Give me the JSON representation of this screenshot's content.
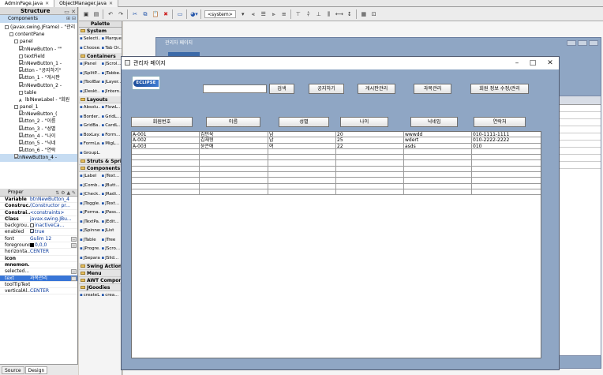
{
  "editor_tabs": [
    {
      "label": "AdminPage.java",
      "active": true
    },
    {
      "label": "ObjectManager.java",
      "active": false
    }
  ],
  "structure": {
    "title": "Structure",
    "components_label": "Components",
    "tree": [
      {
        "label": "(javax.swing.JFrame) - \"관리",
        "indent": 1,
        "icon": "frame"
      },
      {
        "label": "contentPane",
        "indent": 2,
        "icon": "panel"
      },
      {
        "label": "panel",
        "indent": 3,
        "icon": "panel"
      },
      {
        "label": "btnNewButton - \"\"",
        "indent": 4,
        "icon": "btn"
      },
      {
        "label": "textField",
        "indent": 4,
        "icon": "panel"
      },
      {
        "label": "btnNewButton_1 -",
        "indent": 4,
        "icon": "btn"
      },
      {
        "label": "button - \"공지하기\"",
        "indent": 4,
        "icon": "btn"
      },
      {
        "label": "button_1 - \"게시판",
        "indent": 4,
        "icon": "btn"
      },
      {
        "label": "btnNewButton_2 -",
        "indent": 4,
        "icon": "btn"
      },
      {
        "label": "table",
        "indent": 4,
        "icon": "panel"
      },
      {
        "label": "lblNewLabel - \"회원",
        "indent": 4,
        "icon": "lbl"
      },
      {
        "label": "panel_1",
        "indent": 3,
        "icon": "panel"
      },
      {
        "label": "btnNewButton_(",
        "indent": 4,
        "icon": "btn"
      },
      {
        "label": "button_2 - \"이름",
        "indent": 4,
        "icon": "btn"
      },
      {
        "label": "button_3 - \"성별",
        "indent": 4,
        "icon": "btn"
      },
      {
        "label": "button_4 - \"나이",
        "indent": 4,
        "icon": "btn"
      },
      {
        "label": "button_5 - \"닉네",
        "indent": 4,
        "icon": "btn"
      },
      {
        "label": "button_6 - \"연락",
        "indent": 4,
        "icon": "btn"
      },
      {
        "label": "btnNewButton_4 -",
        "indent": 3,
        "icon": "btn",
        "selected": true
      }
    ]
  },
  "properties": {
    "title": "Proper",
    "rows": [
      {
        "key": "Variable",
        "value": "btnNewButton_4",
        "bold": true
      },
      {
        "key": "Construc...",
        "value": "(Constructor pr...",
        "bold": true
      },
      {
        "key": "Constrai...",
        "value": "<constraints>",
        "bold": true
      },
      {
        "key": "Class",
        "value": "javax.swing.JBu...",
        "bold": true
      },
      {
        "key": "backgrou...",
        "value": "inactiveCa...",
        "type": "check"
      },
      {
        "key": "enabled",
        "value": "true",
        "type": "checked"
      },
      {
        "key": "font",
        "value": "Gulim 12",
        "btn": true
      },
      {
        "key": "foreground",
        "value": "0,0,0",
        "type": "swatch",
        "btn": true
      },
      {
        "key": "horizonta...",
        "value": "CENTER"
      },
      {
        "key": "icon",
        "value": "",
        "bold": true
      },
      {
        "key": "mnemon...",
        "value": "",
        "bold": true
      },
      {
        "key": "selected...",
        "value": "",
        "btn": true
      },
      {
        "key": "text",
        "value": "과목관리",
        "selected": true,
        "btn": true
      },
      {
        "key": "toolTipText",
        "value": ""
      },
      {
        "key": "verticalAl...",
        "value": "CENTER"
      }
    ]
  },
  "bottom_tabs": [
    "Source",
    "Design"
  ],
  "toolbar": {
    "system_select": "<system>"
  },
  "palette": {
    "title": "Palette",
    "items": [
      {
        "kind": "cat",
        "label": "System"
      },
      {
        "kind": "row",
        "a": "Selecti...",
        "b": "Marquee"
      },
      {
        "kind": "row",
        "a": "Choose...",
        "b": "Tab Or..."
      },
      {
        "kind": "cat",
        "label": "Containers"
      },
      {
        "kind": "row",
        "a": "JPanel",
        "b": "JScrol..."
      },
      {
        "kind": "row",
        "a": "JSplitP...",
        "b": "JTabbe..."
      },
      {
        "kind": "row",
        "a": "JToolBar",
        "b": "JLayer..."
      },
      {
        "kind": "row",
        "a": "JDeskt...",
        "b": "JIntern..."
      },
      {
        "kind": "cat",
        "label": "Layouts"
      },
      {
        "kind": "row",
        "a": "Absolu...",
        "b": "FlowL..."
      },
      {
        "kind": "row",
        "a": "Border...",
        "b": "GridL..."
      },
      {
        "kind": "row",
        "a": "GridBa...",
        "b": "CardL..."
      },
      {
        "kind": "row",
        "a": "BoxLay...",
        "b": "Form..."
      },
      {
        "kind": "row",
        "a": "FormLa...",
        "b": "MigL..."
      },
      {
        "kind": "row",
        "a": "GroupL...",
        "b": ""
      },
      {
        "kind": "cat",
        "label": "Struts & Springs"
      },
      {
        "kind": "cat",
        "label": "Components"
      },
      {
        "kind": "row",
        "a": "JLabel",
        "b": "JText..."
      },
      {
        "kind": "row",
        "a": "JComb...",
        "b": "JButt..."
      },
      {
        "kind": "row",
        "a": "JCheck...",
        "b": "JRadi..."
      },
      {
        "kind": "row",
        "a": "JToggle...",
        "b": "JText..."
      },
      {
        "kind": "row",
        "a": "JForma...",
        "b": "JPass..."
      },
      {
        "kind": "row",
        "a": "JTextPa...",
        "b": "JEdit..."
      },
      {
        "kind": "row",
        "a": "JSpinner",
        "b": "JList"
      },
      {
        "kind": "row",
        "a": "JTable",
        "b": "JTree"
      },
      {
        "kind": "row",
        "a": "JProgre...",
        "b": "JScro..."
      },
      {
        "kind": "row",
        "a": "JSepara...",
        "b": "JSlid..."
      },
      {
        "kind": "cat",
        "label": "Swing Actions"
      },
      {
        "kind": "cat",
        "label": "Menu"
      },
      {
        "kind": "cat",
        "label": "AWT Components"
      },
      {
        "kind": "cat",
        "label": "JGoodies"
      },
      {
        "kind": "row",
        "a": "createL...",
        "b": "crea..."
      }
    ]
  },
  "background_frame": {
    "title": "관리자 페이지"
  },
  "frame": {
    "title": "관리자 페이지",
    "minimize": "–",
    "maximize": "□",
    "close": "✕",
    "logo_text": "ECLIPSE",
    "search_value": "",
    "buttons": {
      "search": "검색",
      "notice": "공지하기",
      "board": "게시판관리",
      "course": "과목관리",
      "member_edit": "회원 정보 수정/관리"
    },
    "columns": [
      "회원번호",
      "이름",
      "성별",
      "나이",
      "닉네임",
      "연락처"
    ],
    "rows": [
      [
        "A-001",
        "김민욱",
        "남",
        "20",
        "wwwdd",
        "010-1111-1111"
      ],
      [
        "A-002",
        "김재형",
        "남",
        "25",
        "wdert",
        "010-2222-2222"
      ],
      [
        "A-003",
        "윤은애",
        "여",
        "22",
        "asds",
        "010"
      ],
      [
        "",
        "",
        "",
        "",
        "",
        ""
      ],
      [
        "",
        "",
        "",
        "",
        "",
        ""
      ],
      [
        "",
        "",
        "",
        "",
        "",
        ""
      ],
      [
        "",
        "",
        "",
        "",
        "",
        ""
      ],
      [
        "",
        "",
        "",
        "",
        "",
        ""
      ],
      [
        "",
        "",
        "",
        "",
        "",
        ""
      ],
      [
        "",
        "",
        "",
        "",
        "",
        ""
      ],
      [
        "",
        "",
        "",
        "",
        "",
        ""
      ]
    ]
  }
}
